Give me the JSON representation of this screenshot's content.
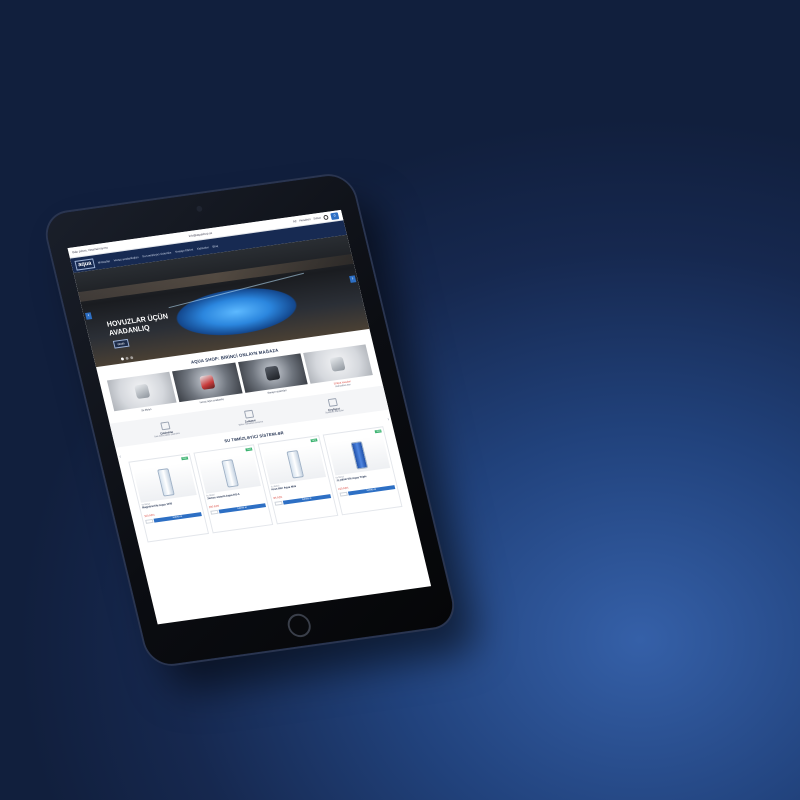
{
  "screen": {
    "topbar": {
      "left_text": "Bakı şəhəri, Yasamal rayonu",
      "center_text": "info@aquashop.az",
      "right_items": [
        "AZ",
        "Hesabım",
        "Səbət"
      ],
      "cart_count": "0"
    },
    "navbar": {
      "logo": "aqua",
      "items": [
        "Məhsullar",
        "Hovuz avadanlıqları",
        "Su təmizləyici sistemlər",
        "Sənaye filtrləri",
        "Xidmətlər",
        "Bloq"
      ]
    },
    "hero": {
      "title_line1": "HOVUZLAR ÜÇÜN",
      "title_line2": "AVADANLIQ",
      "button": "Ətraflı",
      "prev_icon": "‹",
      "next_icon": "›"
    },
    "shop_title": "AQUA SHOP: BİRİNCİ ONLAYN MAĞAZA",
    "categories": [
      {
        "label": "Su filtrləri",
        "sub": "",
        "style": "light",
        "obj": "plain"
      },
      {
        "label": "Hovuz üçün avadanlıq",
        "sub": "",
        "style": "dark",
        "obj": "red"
      },
      {
        "label": "Sənaye sistemləri",
        "sub": "",
        "style": "dark",
        "obj": "dark"
      },
      {
        "label": "Ehtiyat hissələri",
        "sub": "Məhsullara bax",
        "style": "light",
        "obj": "plain"
      }
    ],
    "features": [
      {
        "title": "Çatdırılma",
        "sub": "Bakı daxili pulsuz çatdırılma"
      },
      {
        "title": "Zəmanət",
        "sub": "Bütün məhsullara zəmanət"
      },
      {
        "title": "Keyfiyyət",
        "sub": "Sertifikatlı məhsullar"
      }
    ],
    "systems_title": "SU TƏMİZLƏYİCİ SİSTEMLƏR",
    "products": [
      {
        "badge": "Yeni",
        "category": "Su filtrləri",
        "name": "Magistral filtr Aqua 1000",
        "price": "150 AZN",
        "button": "Səbətə at",
        "vessel": "plain"
      },
      {
        "badge": "Yeni",
        "category": "Su filtrləri",
        "name": "Osmos sistemi Aqua RO-5",
        "price": "290 AZN",
        "button": "Səbətə at",
        "vessel": "plain"
      },
      {
        "badge": "Yeni",
        "category": "Su filtrləri",
        "name": "Kran filtri Aqua Mini",
        "price": "85 AZN",
        "button": "Səbətə at",
        "vessel": "plain"
      },
      {
        "badge": "Yeni",
        "category": "Su filtrləri",
        "name": "Üç pilləli filtr Aqua Triple",
        "price": "210 AZN",
        "button": "Səbətə at",
        "vessel": "blue"
      }
    ],
    "slider_prev": "‹",
    "slider_next": "›"
  },
  "colors": {
    "background": "#1b3264",
    "nav": "#172a52",
    "accent": "#2d6fc4",
    "badge": "#3cb371",
    "price": "#d9443b"
  }
}
